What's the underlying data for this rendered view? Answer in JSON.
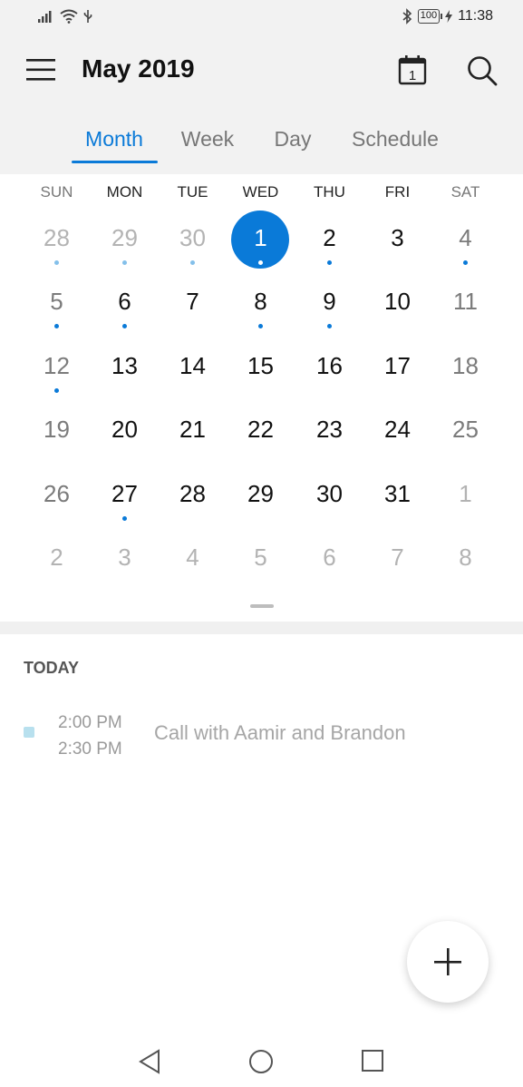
{
  "status": {
    "battery": "100",
    "time": "11:38"
  },
  "header": {
    "title": "May 2019",
    "today_icon_number": "1"
  },
  "tabs": [
    {
      "label": "Month",
      "active": true
    },
    {
      "label": "Week",
      "active": false
    },
    {
      "label": "Day",
      "active": false
    },
    {
      "label": "Schedule",
      "active": false
    }
  ],
  "calendar": {
    "weekdays": [
      "SUN",
      "MON",
      "TUE",
      "WED",
      "THU",
      "FRI",
      "SAT"
    ],
    "weeks": [
      [
        {
          "n": "28",
          "other": true,
          "dot": true
        },
        {
          "n": "29",
          "other": true,
          "dot": true
        },
        {
          "n": "30",
          "other": true,
          "dot": true
        },
        {
          "n": "1",
          "today": true,
          "dot": true
        },
        {
          "n": "2",
          "dot": true
        },
        {
          "n": "3"
        },
        {
          "n": "4",
          "dot": true
        }
      ],
      [
        {
          "n": "5",
          "dot": true
        },
        {
          "n": "6",
          "dot": true
        },
        {
          "n": "7"
        },
        {
          "n": "8",
          "dot": true
        },
        {
          "n": "9",
          "dot": true
        },
        {
          "n": "10"
        },
        {
          "n": "11"
        }
      ],
      [
        {
          "n": "12",
          "dot": true
        },
        {
          "n": "13"
        },
        {
          "n": "14"
        },
        {
          "n": "15"
        },
        {
          "n": "16"
        },
        {
          "n": "17"
        },
        {
          "n": "18"
        }
      ],
      [
        {
          "n": "19"
        },
        {
          "n": "20"
        },
        {
          "n": "21"
        },
        {
          "n": "22"
        },
        {
          "n": "23"
        },
        {
          "n": "24"
        },
        {
          "n": "25"
        }
      ],
      [
        {
          "n": "26"
        },
        {
          "n": "27",
          "dot": true
        },
        {
          "n": "28"
        },
        {
          "n": "29"
        },
        {
          "n": "30"
        },
        {
          "n": "31"
        },
        {
          "n": "1",
          "other": true
        }
      ],
      [
        {
          "n": "2",
          "other": true
        },
        {
          "n": "3",
          "other": true
        },
        {
          "n": "4",
          "other": true
        },
        {
          "n": "5",
          "other": true
        },
        {
          "n": "6",
          "other": true
        },
        {
          "n": "7",
          "other": true
        },
        {
          "n": "8",
          "other": true
        }
      ]
    ]
  },
  "agenda": {
    "section_label": "TODAY",
    "events": [
      {
        "start": "2:00 PM",
        "end": "2:30 PM",
        "title": "Call with Aamir and Brandon",
        "color": "#b8e0ee"
      }
    ]
  },
  "colors": {
    "accent": "#0a7ad8",
    "header_bg": "#f2f2f2"
  },
  "icons": {
    "menu": "menu-icon",
    "today": "calendar-today-icon",
    "search": "search-icon",
    "add": "plus-icon",
    "nav_back": "triangle-back-icon",
    "nav_home": "circle-home-icon",
    "nav_recent": "square-recents-icon"
  }
}
